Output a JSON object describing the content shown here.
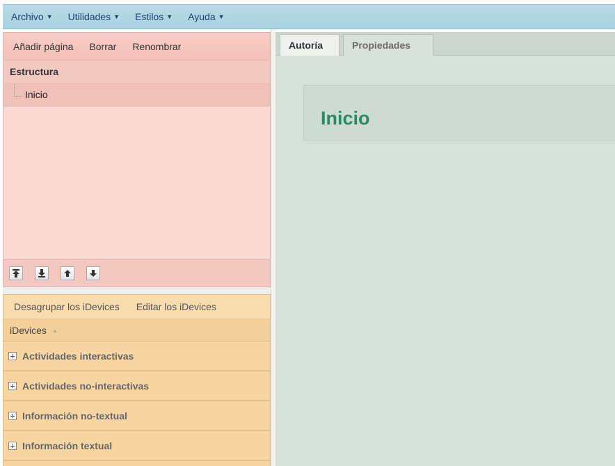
{
  "menubar": {
    "items": [
      {
        "label": "Archivo"
      },
      {
        "label": "Utilidades"
      },
      {
        "label": "Estilos"
      },
      {
        "label": "Ayuda"
      }
    ]
  },
  "structure": {
    "toolbar": {
      "add_label": "Añadir página",
      "delete_label": "Borrar",
      "rename_label": "Renombrar"
    },
    "header": "Estructura",
    "tree": [
      {
        "label": "Inicio",
        "selected": true
      }
    ],
    "nav_buttons": [
      {
        "icon": "move-top-icon"
      },
      {
        "icon": "move-bottom-icon"
      },
      {
        "icon": "move-up-icon"
      },
      {
        "icon": "move-down-icon"
      }
    ]
  },
  "idevices": {
    "toolbar": {
      "ungroup_label": "Desagrupar los iDevices",
      "edit_label": "Editar los iDevices"
    },
    "header": "iDevices",
    "categories": [
      {
        "label": "Actividades interactivas"
      },
      {
        "label": "Actividades no-interactivas"
      },
      {
        "label": "Información no-textual"
      },
      {
        "label": "Información textual"
      }
    ]
  },
  "tabs": [
    {
      "label": "Autoría",
      "active": true
    },
    {
      "label": "Propiedades",
      "active": false
    }
  ],
  "content": {
    "page_title": "Inicio"
  },
  "colors": {
    "menubar": "#b8dbe6",
    "structure_bg": "#fcd8d2",
    "idevices_bg": "#f6d5a2",
    "content_bg": "#d4e0d8",
    "title_accent": "#2a8a66"
  }
}
